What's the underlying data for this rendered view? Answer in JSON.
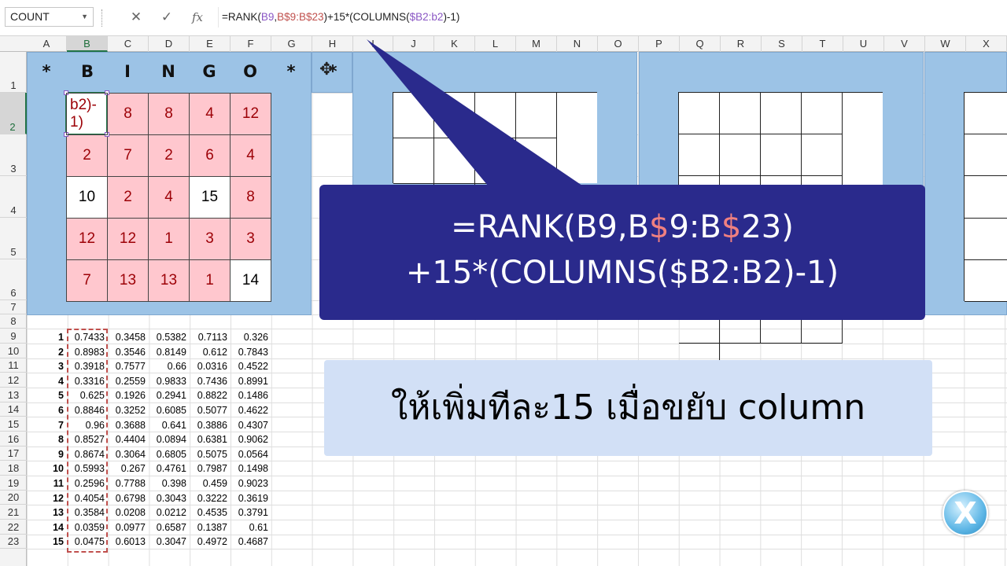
{
  "namebox": {
    "value": "COUNT"
  },
  "formula": {
    "p1": "=RANK(",
    "p2": "B9",
    "p3": ",",
    "p4": "B$9:B$23",
    "p5": ")+15*(COLUMNS(",
    "p6": "$B2:b2",
    "p7": ")-1)"
  },
  "icons": {
    "cancel": "close-icon",
    "enter": "check-icon",
    "fx": "function-icon"
  },
  "columns": [
    "A",
    "B",
    "C",
    "D",
    "E",
    "F",
    "G",
    "H",
    "I",
    "J",
    "K",
    "L",
    "M",
    "N",
    "O",
    "P",
    "Q",
    "R",
    "S",
    "T",
    "U",
    "V",
    "W",
    "X"
  ],
  "rows": [
    "1",
    "2",
    "3",
    "4",
    "5",
    "6",
    "7",
    "8",
    "9",
    "10",
    "11",
    "12",
    "13",
    "14",
    "15",
    "16",
    "17",
    "18",
    "19",
    "20",
    "21",
    "22",
    "23"
  ],
  "bingo": {
    "star_left": "*",
    "letters": [
      "B",
      "I",
      "N",
      "G",
      "O"
    ],
    "star_right": "*",
    "star_h": "*"
  },
  "card": [
    [
      "b2)-\n1)",
      "8",
      "8",
      "4",
      "12"
    ],
    [
      "2",
      "7",
      "2",
      "6",
      "4"
    ],
    [
      "10",
      "2",
      "4",
      "15",
      "8"
    ],
    [
      "12",
      "12",
      "1",
      "3",
      "3"
    ],
    [
      "7",
      "13",
      "13",
      "1",
      "14"
    ]
  ],
  "card_white": [
    [
      2,
      0
    ],
    [
      2,
      3
    ],
    [
      5,
      4
    ]
  ],
  "table": [
    [
      "1",
      "0.7433",
      "0.3458",
      "0.5382",
      "0.7113",
      "0.326"
    ],
    [
      "2",
      "0.8983",
      "0.3546",
      "0.8149",
      "0.612",
      "0.7843"
    ],
    [
      "3",
      "0.3918",
      "0.7577",
      "0.66",
      "0.0316",
      "0.4522"
    ],
    [
      "4",
      "0.3316",
      "0.2559",
      "0.9833",
      "0.7436",
      "0.8991"
    ],
    [
      "5",
      "0.625",
      "0.1926",
      "0.2941",
      "0.8822",
      "0.1486"
    ],
    [
      "6",
      "0.8846",
      "0.3252",
      "0.6085",
      "0.5077",
      "0.4622"
    ],
    [
      "7",
      "0.96",
      "0.3688",
      "0.641",
      "0.3886",
      "0.4307"
    ],
    [
      "8",
      "0.8527",
      "0.4404",
      "0.0894",
      "0.6381",
      "0.9062"
    ],
    [
      "9",
      "0.8674",
      "0.3064",
      "0.6805",
      "0.5075",
      "0.0564"
    ],
    [
      "10",
      "0.5993",
      "0.267",
      "0.4761",
      "0.7987",
      "0.1498"
    ],
    [
      "11",
      "0.2596",
      "0.7788",
      "0.398",
      "0.459",
      "0.9023"
    ],
    [
      "12",
      "0.4054",
      "0.6798",
      "0.3043",
      "0.3222",
      "0.3619"
    ],
    [
      "13",
      "0.3584",
      "0.0208",
      "0.0212",
      "0.4535",
      "0.3791"
    ],
    [
      "14",
      "0.0359",
      "0.0977",
      "0.6587",
      "0.1387",
      "0.61"
    ],
    [
      "15",
      "0.0475",
      "0.6013",
      "0.3047",
      "0.4972",
      "0.4687"
    ]
  ],
  "callout1": {
    "l1a": "=RANK(B9,B",
    "l1b": "$",
    "l1c": "9:B",
    "l1d": "$",
    "l1e": "23)",
    "line2": "+15*(COLUMNS($B2:B2)-1)"
  },
  "callout2": {
    "text": "ให้เพิ่มทีละ15 เมื่อขยับ column"
  },
  "logo": {
    "letter": "X"
  }
}
